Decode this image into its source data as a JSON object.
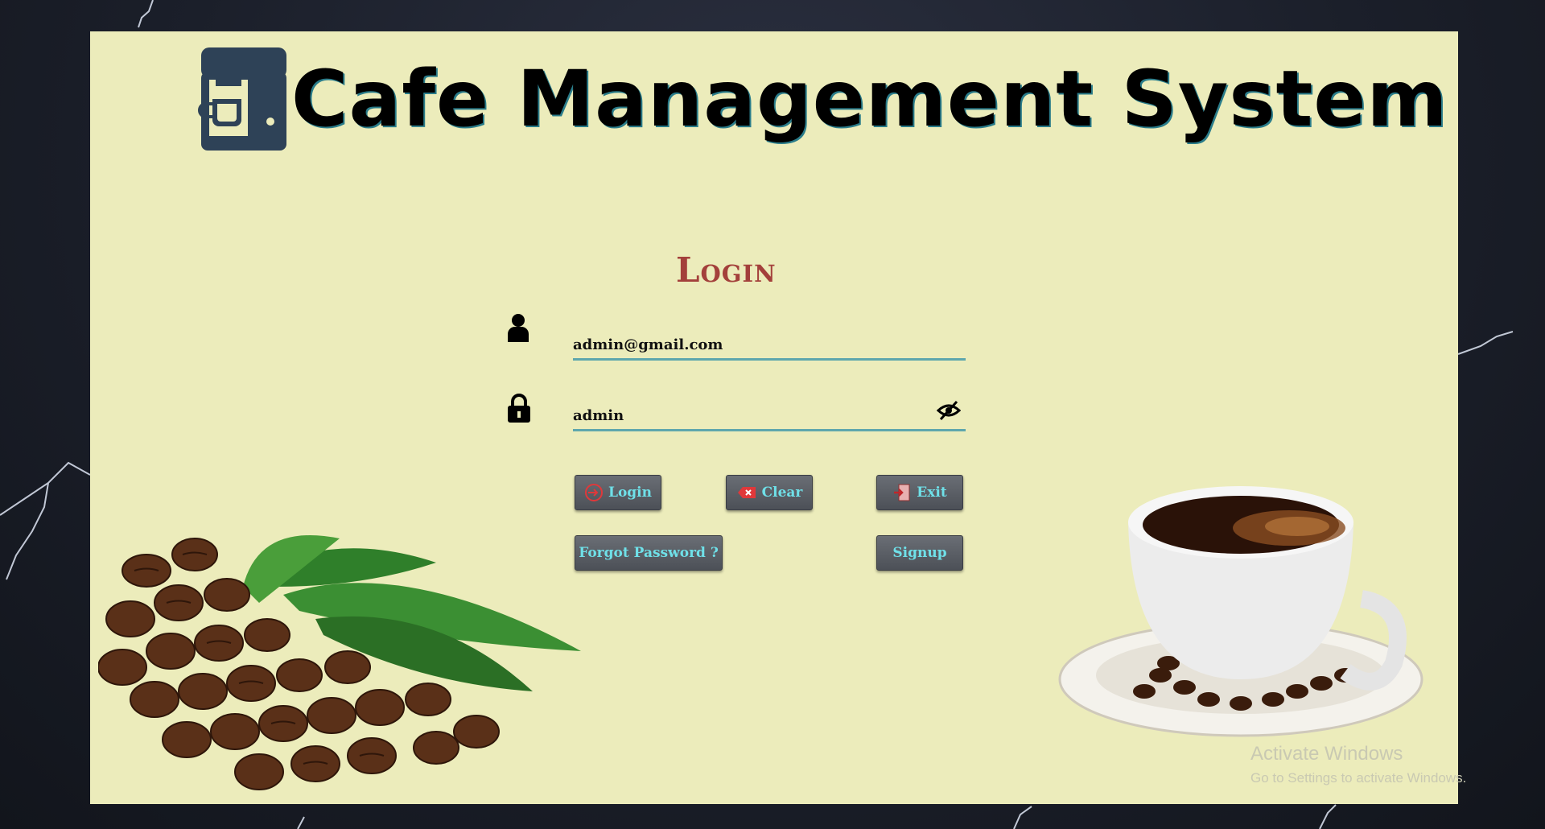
{
  "app": {
    "title": "Cafe Management System"
  },
  "login": {
    "heading": "Login",
    "email_value": "admin@gmail.com",
    "password_value": "admin",
    "user_icon": "user-icon",
    "lock_icon": "lock-icon",
    "eye_icon": "eye-slash-icon"
  },
  "buttons": {
    "login": "Login",
    "clear": "Clear",
    "exit": "Exit",
    "forgot": "Forgot Password ?",
    "signup": "Signup"
  },
  "watermark": {
    "line1": "Activate Windows",
    "line2": "Go to Settings to activate Windows."
  },
  "colors": {
    "panel": "#ececbb",
    "heading": "#a3403b",
    "button_text": "#6fe0e8",
    "field_underline": "#5ea7ad"
  }
}
